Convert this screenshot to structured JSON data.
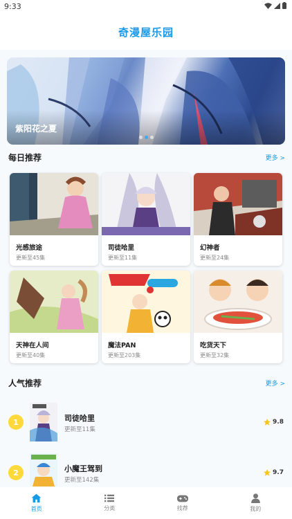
{
  "status_bar": {
    "time": "9:33"
  },
  "app": {
    "title": "奇漫屋乐园"
  },
  "banner": {
    "title": "紫阳花之夏",
    "dots": 3,
    "active_dot": 1
  },
  "daily": {
    "title": "每日推荐",
    "more": "更多 >",
    "items": [
      {
        "title": "光感旅途",
        "update": "更新至45集"
      },
      {
        "title": "司徒哈里",
        "update": "更新至11集"
      },
      {
        "title": "幻神者",
        "update": "更新至24集"
      },
      {
        "title": "天神在人间",
        "update": "更新至40集"
      },
      {
        "title": "魔法PAN",
        "update": "更新至203集"
      },
      {
        "title": "吃货天下",
        "update": "更新至32集"
      }
    ]
  },
  "popular": {
    "title": "人气推荐",
    "more": "更多 >",
    "items": [
      {
        "rank": "1",
        "title": "司徒哈里",
        "update": "更新至11集",
        "score": "9.8"
      },
      {
        "rank": "2",
        "title": "小魔王驾到",
        "update": "更新至142集",
        "score": "9.7"
      }
    ]
  },
  "tabs": [
    {
      "label": "首页",
      "icon": "home-icon",
      "active": true
    },
    {
      "label": "分类",
      "icon": "list-icon",
      "active": false
    },
    {
      "label": "找荐",
      "icon": "gamepad-icon",
      "active": false
    },
    {
      "label": "我的",
      "icon": "user-icon",
      "active": false
    }
  ],
  "colors": {
    "accent": "#1a9ae6",
    "rank_badge": "#ffd93b",
    "star": "#f5c518"
  }
}
